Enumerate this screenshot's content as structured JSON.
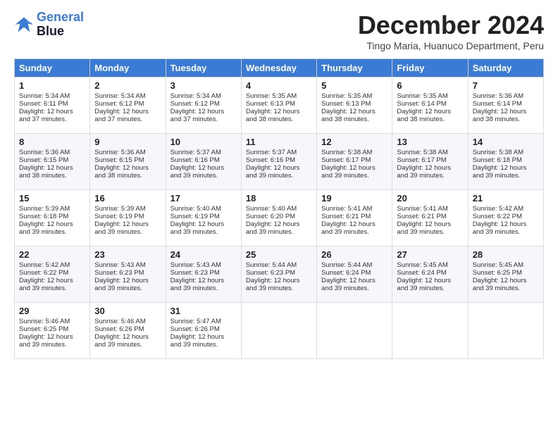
{
  "logo": {
    "line1": "General",
    "line2": "Blue"
  },
  "title": "December 2024",
  "subtitle": "Tingo Maria, Huanuco Department, Peru",
  "days_of_week": [
    "Sunday",
    "Monday",
    "Tuesday",
    "Wednesday",
    "Thursday",
    "Friday",
    "Saturday"
  ],
  "weeks": [
    [
      {
        "day": "1",
        "sunrise": "Sunrise: 5:34 AM",
        "sunset": "Sunset: 6:11 PM",
        "daylight": "Daylight: 12 hours and 37 minutes."
      },
      {
        "day": "2",
        "sunrise": "Sunrise: 5:34 AM",
        "sunset": "Sunset: 6:12 PM",
        "daylight": "Daylight: 12 hours and 37 minutes."
      },
      {
        "day": "3",
        "sunrise": "Sunrise: 5:34 AM",
        "sunset": "Sunset: 6:12 PM",
        "daylight": "Daylight: 12 hours and 37 minutes."
      },
      {
        "day": "4",
        "sunrise": "Sunrise: 5:35 AM",
        "sunset": "Sunset: 6:13 PM",
        "daylight": "Daylight: 12 hours and 38 minutes."
      },
      {
        "day": "5",
        "sunrise": "Sunrise: 5:35 AM",
        "sunset": "Sunset: 6:13 PM",
        "daylight": "Daylight: 12 hours and 38 minutes."
      },
      {
        "day": "6",
        "sunrise": "Sunrise: 5:35 AM",
        "sunset": "Sunset: 6:14 PM",
        "daylight": "Daylight: 12 hours and 38 minutes."
      },
      {
        "day": "7",
        "sunrise": "Sunrise: 5:36 AM",
        "sunset": "Sunset: 6:14 PM",
        "daylight": "Daylight: 12 hours and 38 minutes."
      }
    ],
    [
      {
        "day": "8",
        "sunrise": "Sunrise: 5:36 AM",
        "sunset": "Sunset: 6:15 PM",
        "daylight": "Daylight: 12 hours and 38 minutes."
      },
      {
        "day": "9",
        "sunrise": "Sunrise: 5:36 AM",
        "sunset": "Sunset: 6:15 PM",
        "daylight": "Daylight: 12 hours and 38 minutes."
      },
      {
        "day": "10",
        "sunrise": "Sunrise: 5:37 AM",
        "sunset": "Sunset: 6:16 PM",
        "daylight": "Daylight: 12 hours and 39 minutes."
      },
      {
        "day": "11",
        "sunrise": "Sunrise: 5:37 AM",
        "sunset": "Sunset: 6:16 PM",
        "daylight": "Daylight: 12 hours and 39 minutes."
      },
      {
        "day": "12",
        "sunrise": "Sunrise: 5:38 AM",
        "sunset": "Sunset: 6:17 PM",
        "daylight": "Daylight: 12 hours and 39 minutes."
      },
      {
        "day": "13",
        "sunrise": "Sunrise: 5:38 AM",
        "sunset": "Sunset: 6:17 PM",
        "daylight": "Daylight: 12 hours and 39 minutes."
      },
      {
        "day": "14",
        "sunrise": "Sunrise: 5:38 AM",
        "sunset": "Sunset: 6:18 PM",
        "daylight": "Daylight: 12 hours and 39 minutes."
      }
    ],
    [
      {
        "day": "15",
        "sunrise": "Sunrise: 5:39 AM",
        "sunset": "Sunset: 6:18 PM",
        "daylight": "Daylight: 12 hours and 39 minutes."
      },
      {
        "day": "16",
        "sunrise": "Sunrise: 5:39 AM",
        "sunset": "Sunset: 6:19 PM",
        "daylight": "Daylight: 12 hours and 39 minutes."
      },
      {
        "day": "17",
        "sunrise": "Sunrise: 5:40 AM",
        "sunset": "Sunset: 6:19 PM",
        "daylight": "Daylight: 12 hours and 39 minutes."
      },
      {
        "day": "18",
        "sunrise": "Sunrise: 5:40 AM",
        "sunset": "Sunset: 6:20 PM",
        "daylight": "Daylight: 12 hours and 39 minutes."
      },
      {
        "day": "19",
        "sunrise": "Sunrise: 5:41 AM",
        "sunset": "Sunset: 6:21 PM",
        "daylight": "Daylight: 12 hours and 39 minutes."
      },
      {
        "day": "20",
        "sunrise": "Sunrise: 5:41 AM",
        "sunset": "Sunset: 6:21 PM",
        "daylight": "Daylight: 12 hours and 39 minutes."
      },
      {
        "day": "21",
        "sunrise": "Sunrise: 5:42 AM",
        "sunset": "Sunset: 6:22 PM",
        "daylight": "Daylight: 12 hours and 39 minutes."
      }
    ],
    [
      {
        "day": "22",
        "sunrise": "Sunrise: 5:42 AM",
        "sunset": "Sunset: 6:22 PM",
        "daylight": "Daylight: 12 hours and 39 minutes."
      },
      {
        "day": "23",
        "sunrise": "Sunrise: 5:43 AM",
        "sunset": "Sunset: 6:23 PM",
        "daylight": "Daylight: 12 hours and 39 minutes."
      },
      {
        "day": "24",
        "sunrise": "Sunrise: 5:43 AM",
        "sunset": "Sunset: 6:23 PM",
        "daylight": "Daylight: 12 hours and 39 minutes."
      },
      {
        "day": "25",
        "sunrise": "Sunrise: 5:44 AM",
        "sunset": "Sunset: 6:23 PM",
        "daylight": "Daylight: 12 hours and 39 minutes."
      },
      {
        "day": "26",
        "sunrise": "Sunrise: 5:44 AM",
        "sunset": "Sunset: 6:24 PM",
        "daylight": "Daylight: 12 hours and 39 minutes."
      },
      {
        "day": "27",
        "sunrise": "Sunrise: 5:45 AM",
        "sunset": "Sunset: 6:24 PM",
        "daylight": "Daylight: 12 hours and 39 minutes."
      },
      {
        "day": "28",
        "sunrise": "Sunrise: 5:45 AM",
        "sunset": "Sunset: 6:25 PM",
        "daylight": "Daylight: 12 hours and 39 minutes."
      }
    ],
    [
      {
        "day": "29",
        "sunrise": "Sunrise: 5:46 AM",
        "sunset": "Sunset: 6:25 PM",
        "daylight": "Daylight: 12 hours and 39 minutes."
      },
      {
        "day": "30",
        "sunrise": "Sunrise: 5:46 AM",
        "sunset": "Sunset: 6:26 PM",
        "daylight": "Daylight: 12 hours and 39 minutes."
      },
      {
        "day": "31",
        "sunrise": "Sunrise: 5:47 AM",
        "sunset": "Sunset: 6:26 PM",
        "daylight": "Daylight: 12 hours and 39 minutes."
      },
      null,
      null,
      null,
      null
    ]
  ]
}
